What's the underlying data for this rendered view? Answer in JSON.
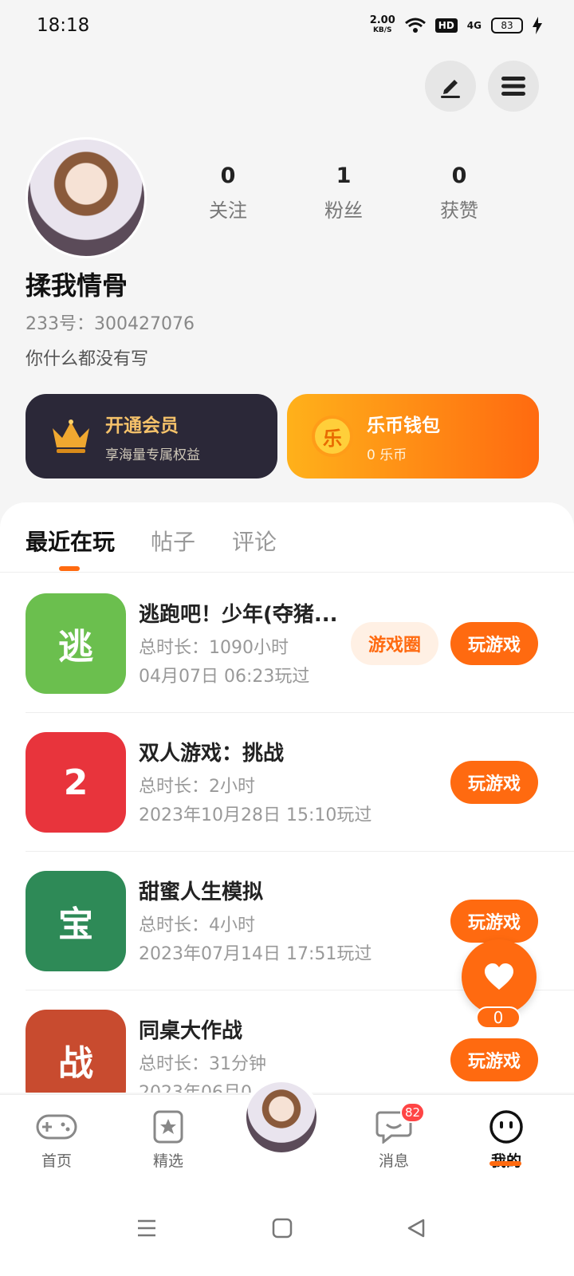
{
  "status_bar": {
    "time": "18:18",
    "net_speed_value": "2.00",
    "net_speed_unit": "KB/S",
    "hd": "HD",
    "signal": "4G",
    "battery": "83"
  },
  "profile": {
    "stats": [
      {
        "value": "0",
        "label": "关注"
      },
      {
        "value": "1",
        "label": "粉丝"
      },
      {
        "value": "0",
        "label": "获赞"
      }
    ],
    "name": "揉我情骨",
    "uid": "233号：300427076",
    "bio": "你什么都没有写"
  },
  "cards": {
    "vip": {
      "title": "开通会员",
      "subtitle": "享海量专属权益"
    },
    "wallet": {
      "coin_glyph": "乐",
      "title": "乐币钱包",
      "subtitle": "0 乐币"
    }
  },
  "tabs": [
    "最近在玩",
    "帖子",
    "评论"
  ],
  "games": [
    {
      "name": "逃跑吧！少年(夺猪...",
      "duration": "总时长：1090小时",
      "last_played": "04月07日 06:23玩过",
      "circle_label": "游戏圈",
      "play_label": "玩游戏",
      "icon_glyph": "逃",
      "icon_color": "#6bbf4e"
    },
    {
      "name": "双人游戏：挑战",
      "duration": "总时长：2小时",
      "last_played": "2023年10月28日 15:10玩过",
      "play_label": "玩游戏",
      "icon_glyph": "2",
      "icon_color": "#e8343c"
    },
    {
      "name": "甜蜜人生模拟",
      "duration": "总时长：4小时",
      "last_played": "2023年07月14日 17:51玩过",
      "play_label": "玩游戏",
      "icon_glyph": "宝",
      "icon_color": "#2e8a57"
    },
    {
      "name": "同桌大作战",
      "duration": "总时长：31分钟",
      "last_played": "2023年06月0",
      "play_label": "玩游戏",
      "icon_glyph": "战",
      "icon_color": "#c84b2f"
    }
  ],
  "fab": {
    "count": "0"
  },
  "bottom_nav": {
    "items": [
      {
        "label": "首页",
        "icon": "gamepad-icon"
      },
      {
        "label": "精选",
        "icon": "star-card-icon"
      },
      {
        "label": "消息",
        "icon": "chat-icon"
      },
      {
        "label": "我的",
        "icon": "smiley-icon"
      }
    ],
    "message_badge": "82"
  },
  "colors": {
    "accent": "#ff6a10",
    "vip_dark": "#2b2838",
    "vip_gold": "#f5c26a"
  }
}
